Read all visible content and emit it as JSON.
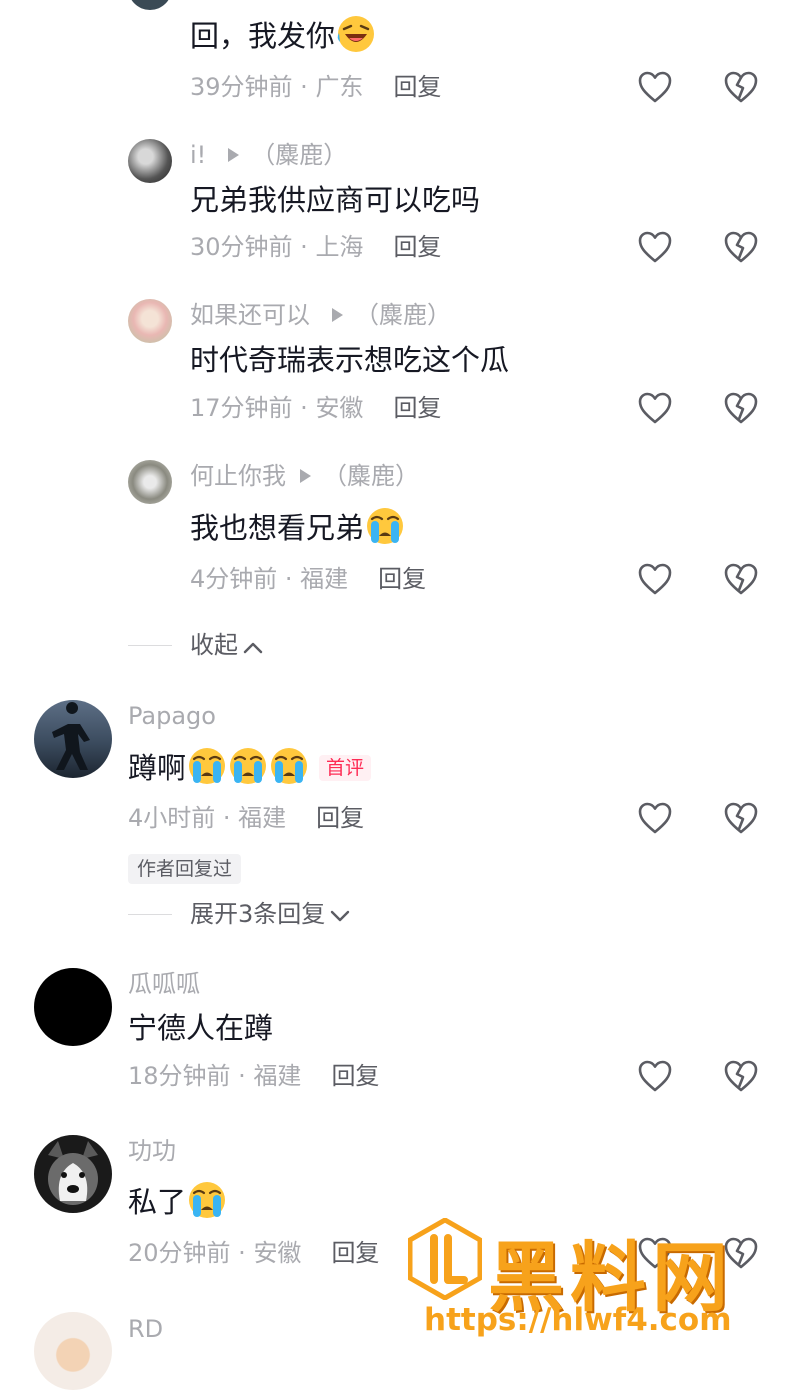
{
  "colors": {
    "text": "#161823",
    "muted": "#a9aaaf",
    "reply": "#5b5c63",
    "badge_red": "#fe2c55",
    "watermark": "#f7a21b"
  },
  "comments": [
    {
      "text": "回，我发你",
      "emoji": "laughing-emoji",
      "time": "39分钟前",
      "location": "广东",
      "reply_label": "回复"
    },
    {
      "user": "i!",
      "reply_to": "（麋鹿）",
      "text": "兄弟我供应商可以吃吗",
      "time": "30分钟前",
      "location": "上海",
      "reply_label": "回复"
    },
    {
      "user": "如果还可以",
      "reply_to": "（麋鹿）",
      "text": "时代奇瑞表示想吃这个瓜",
      "time": "17分钟前",
      "location": "安徽",
      "reply_label": "回复"
    },
    {
      "user": "何止你我",
      "reply_to": "（麋鹿）",
      "text": "我也想看兄弟",
      "emoji": "crying-emoji",
      "time": "4分钟前",
      "location": "福建",
      "reply_label": "回复"
    },
    {
      "user": "Papago",
      "text": "蹲啊",
      "emoji_count": 3,
      "badge": "首评",
      "time": "4小时前",
      "location": "福建",
      "reply_label": "回复",
      "author_tag": "作者回复过",
      "expand_label": "展开3条回复"
    },
    {
      "user": "瓜呱呱",
      "text": "宁德人在蹲",
      "time": "18分钟前",
      "location": "福建",
      "reply_label": "回复"
    },
    {
      "user": "功功",
      "text": "私了",
      "emoji": "crying-emoji",
      "time": "20分钟前",
      "location": "安徽",
      "reply_label": "回复"
    },
    {
      "user": "RD"
    }
  ],
  "collapse_label": "收起",
  "watermark": {
    "title": "黑料网",
    "url": "https://hlwf4.com"
  }
}
